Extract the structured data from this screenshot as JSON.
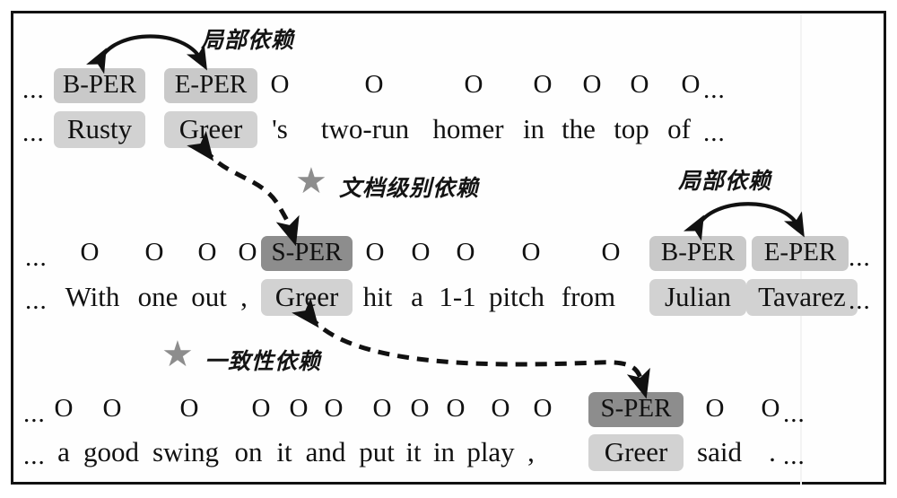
{
  "figure": {
    "border_color": "#121212",
    "background": "#ffffff",
    "tag_box_color_dark": "#8d8d8d",
    "tag_box_color_light": "#c9c9c9",
    "word_box_color": "#d2d2d2",
    "arrow_color": "#111111",
    "star_color": "#8d8d8d",
    "ellipsis": "...",
    "star_glyph": "★"
  },
  "labels": {
    "local_dependency_top": "局部依赖",
    "local_dependency_right": "局部依赖",
    "document_level_dependency": "文档级别依赖",
    "consistency_dependency": "一致性依赖"
  },
  "sentences": [
    {
      "id": "sentence-1",
      "lead_ellipsis": "...",
      "trail_ellipsis": "...",
      "tags": [
        "B-PER",
        "E-PER",
        "O",
        "O",
        "O",
        "O",
        "O",
        "O",
        "O"
      ],
      "words": [
        "Rusty",
        "Greer",
        "'s",
        "two-run",
        "homer",
        "in",
        "the",
        "top",
        "of"
      ],
      "highlight": [
        "dark-light",
        "dark-light",
        "none",
        "none",
        "none",
        "none",
        "none",
        "none",
        "none"
      ]
    },
    {
      "id": "sentence-2",
      "lead_ellipsis": "...",
      "trail_ellipsis": "...",
      "tags": [
        "O",
        "O",
        "O",
        "O",
        "S-PER",
        "O",
        "O",
        "O",
        "O",
        "O",
        "B-PER",
        "E-PER"
      ],
      "words": [
        "With",
        "one",
        "out",
        ",",
        "Greer",
        "hit",
        "a",
        "1-1",
        "pitch",
        "from",
        "Julian",
        "Tavarez"
      ],
      "highlight": [
        "none",
        "none",
        "none",
        "none",
        "dark",
        "none",
        "none",
        "none",
        "none",
        "none",
        "light",
        "light"
      ]
    },
    {
      "id": "sentence-3",
      "lead_ellipsis": "...",
      "trail_ellipsis": "...",
      "tags": [
        "O",
        "O",
        "O",
        "O",
        "O",
        "O",
        "O",
        "O",
        "O",
        "O",
        "O",
        "S-PER",
        "O",
        "O"
      ],
      "words": [
        "a",
        "good",
        "swing",
        "on",
        "it",
        "and",
        "put",
        "it",
        "in",
        "play",
        ",",
        "Greer",
        "said",
        "."
      ],
      "highlight": [
        "none",
        "none",
        "none",
        "none",
        "none",
        "none",
        "none",
        "none",
        "none",
        "none",
        "none",
        "dark",
        "none",
        "none"
      ]
    }
  ],
  "arrows": [
    {
      "id": "arrow-local-top",
      "style": "solid",
      "heads": "both",
      "relation": "局部依赖",
      "from": "B-PER (Rusty)",
      "to": "E-PER (Greer)"
    },
    {
      "id": "arrow-local-right",
      "style": "solid",
      "heads": "both",
      "relation": "局部依赖",
      "from": "B-PER (Julian)",
      "to": "E-PER (Tavarez)"
    },
    {
      "id": "arrow-document-level",
      "style": "dashed",
      "heads": "both",
      "relation": "文档级别依赖",
      "from": "Greer (sentence 1)",
      "to": "S-PER (sentence 2)"
    },
    {
      "id": "arrow-consistency",
      "style": "dashed",
      "heads": "both",
      "relation": "一致性依赖",
      "from": "S-PER (sentence 2)",
      "to": "S-PER (sentence 3)"
    }
  ]
}
